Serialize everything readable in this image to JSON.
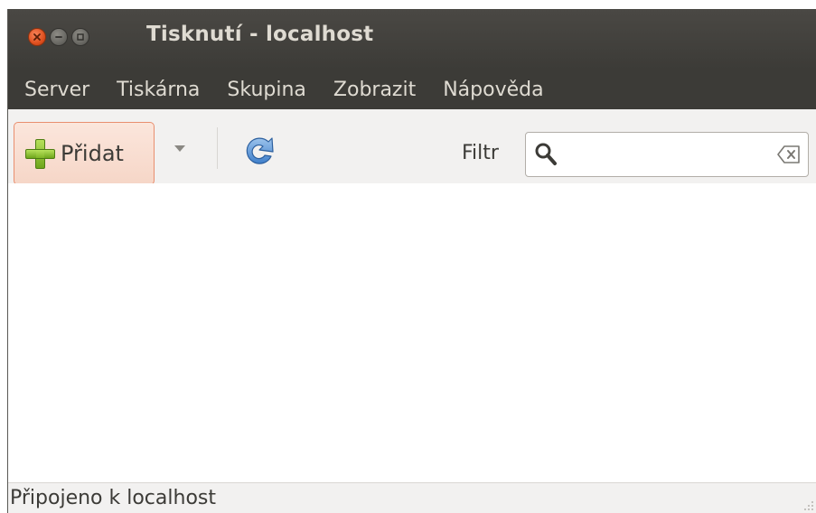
{
  "window": {
    "title": "Tisknutí - localhost"
  },
  "menubar": {
    "items": [
      {
        "label": "Server"
      },
      {
        "label": "Tiskárna"
      },
      {
        "label": "Skupina"
      },
      {
        "label": "Zobrazit"
      },
      {
        "label": "Nápověda"
      }
    ]
  },
  "toolbar": {
    "add_label": "Přidat",
    "filter_label": "Filtr",
    "search_value": "",
    "icons": {
      "add": "plus-icon",
      "dropdown": "chevron-down-icon",
      "refresh": "refresh-icon",
      "search": "search-icon",
      "clear": "clear-icon"
    }
  },
  "statusbar": {
    "text": "Připojeno k localhost"
  },
  "colors": {
    "titlebar": "#3c3b37",
    "title_text": "#dfdbd2",
    "close_button": "#e0501f",
    "add_button_border": "#e98f6f",
    "add_button_bg": "#fbe6dc",
    "window_bg": "#f2f1f0"
  }
}
